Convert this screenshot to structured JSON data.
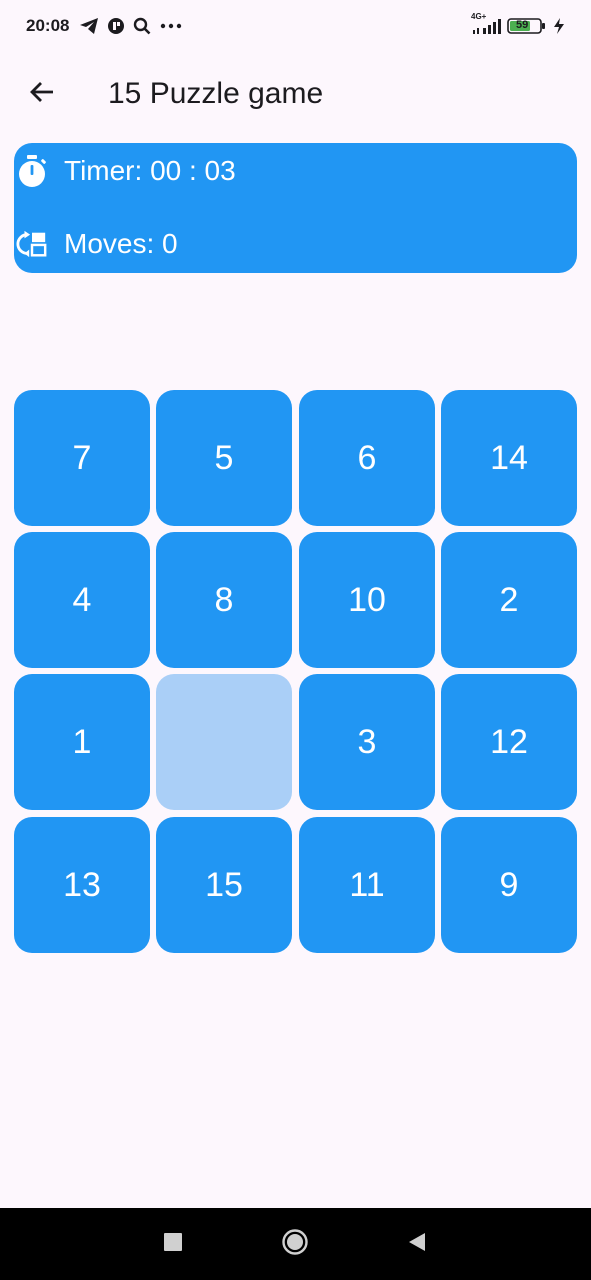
{
  "status_bar": {
    "time": "20:08",
    "network": "4G+",
    "battery": "59"
  },
  "app_bar": {
    "title": "15 Puzzle game",
    "back_icon": "arrow-back-icon"
  },
  "info": {
    "timer_label": "Timer: 00 : 03",
    "moves_label": "Moves: 0",
    "timer_icon": "stopwatch-icon",
    "moves_icon": "swap-moves-icon"
  },
  "board": {
    "tiles": [
      "7",
      "5",
      "6",
      "14",
      "4",
      "8",
      "10",
      "2",
      "1",
      "",
      "3",
      "12",
      "13",
      "15",
      "11",
      "9"
    ]
  },
  "colors": {
    "tile": "#2196f3",
    "empty_tile": "#aacff7",
    "background": "#fdf7fd"
  }
}
